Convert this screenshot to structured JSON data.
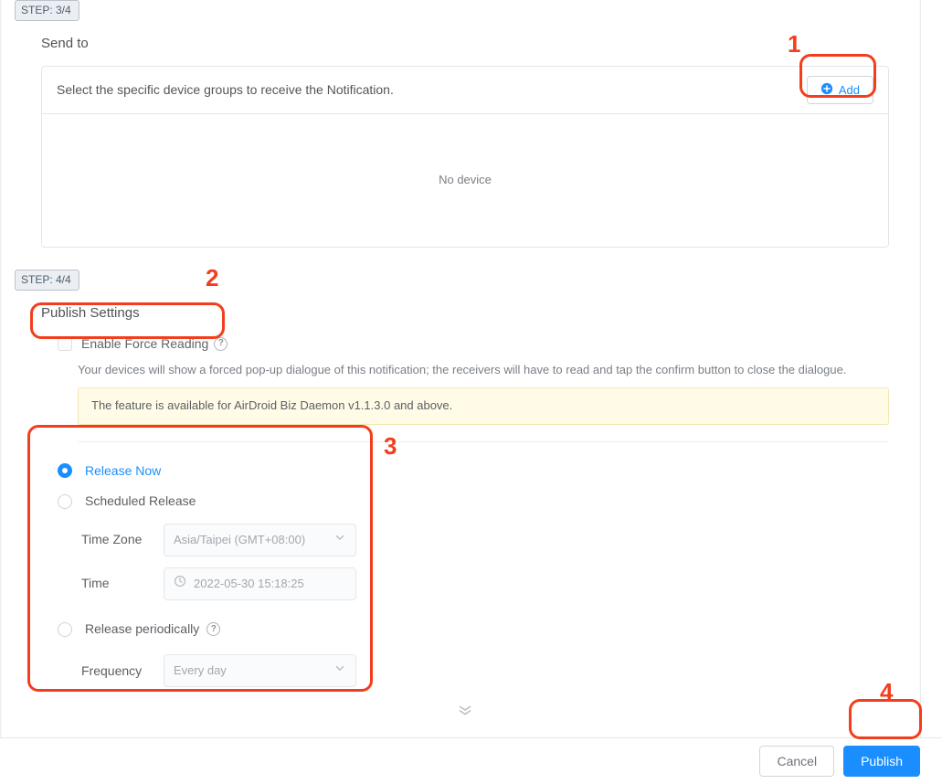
{
  "step3": {
    "badge": "STEP: 3/4",
    "title": "Send to",
    "instruction": "Select the specific device groups to receive the Notification.",
    "add_label": "Add",
    "empty": "No device"
  },
  "step4": {
    "badge": "STEP: 4/4",
    "title": "Publish Settings",
    "force_label": "Enable Force Reading",
    "force_desc": "Your devices will show a forced pop-up dialogue of this notification; the receivers will have to read and tap the confirm button to close the dialogue.",
    "notice": "The feature is available for AirDroid Biz Daemon v1.1.3.0 and above.",
    "release": {
      "now": "Release Now",
      "scheduled": "Scheduled Release",
      "tz_label": "Time Zone",
      "tz_value": "Asia/Taipei (GMT+08:00)",
      "time_label": "Time",
      "time_value": "2022-05-30 15:18:25",
      "periodic": "Release periodically",
      "freq_label": "Frequency",
      "freq_value": "Every day",
      "selected": "now"
    }
  },
  "footer": {
    "cancel": "Cancel",
    "publish": "Publish"
  },
  "annotations": {
    "n1": "1",
    "n2": "2",
    "n3": "3",
    "n4": "4"
  }
}
